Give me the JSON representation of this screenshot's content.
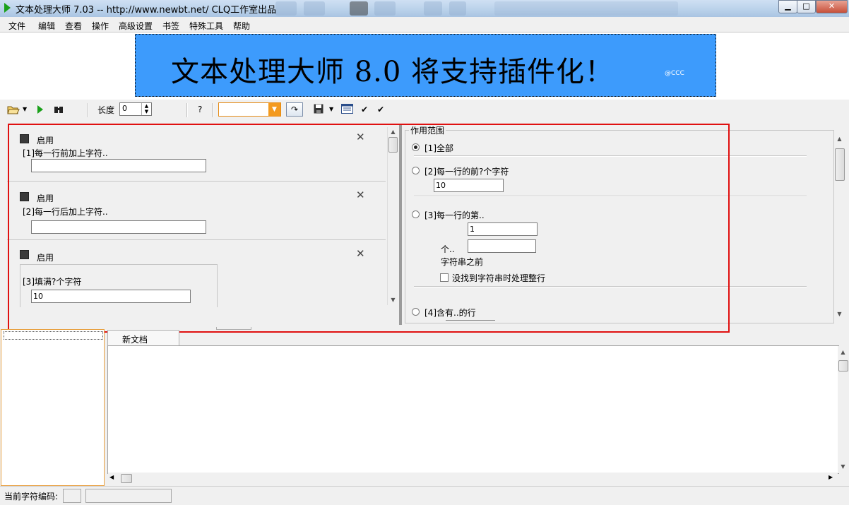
{
  "window": {
    "title": "文本处理大师 7.03 -- http://www.newbt.net/  CLQ工作室出品",
    "minimize_label": "▁",
    "maximize_label": "□",
    "close_label": "✕"
  },
  "menu": [
    "文件",
    "编辑",
    "查看",
    "操作",
    "高级设置",
    "书签",
    "特殊工具",
    "帮助"
  ],
  "banner": {
    "text": "文本处理大师 8.0 将支持插件化！",
    "small": "@CCC",
    "color": "#3d9bfc"
  },
  "toolbar": {
    "length_label": "长度",
    "length_value": "0",
    "help_label": "?",
    "combo_value": ""
  },
  "plugins": [
    {
      "enable_label": "启用",
      "description": "[1]每一行前加上字符..",
      "input_value": ""
    },
    {
      "enable_label": "启用",
      "description": "[2]每一行后加上字符..",
      "input_value": ""
    },
    {
      "enable_label": "启用",
      "description": "[3]填满?个字符",
      "input_value": "10"
    }
  ],
  "scope": {
    "title": "作用范围",
    "options": [
      {
        "label": "[1]全部",
        "selected": true
      },
      {
        "label": "[2]每一行的前?个字符",
        "selected": false,
        "input_value": "10"
      },
      {
        "label": "[3]每一行的第..",
        "selected": false,
        "input_value": "1",
        "count_label": "个..",
        "count_value": "",
        "suffix_label": "字符串之前",
        "checkbox_label": "没找到字符串时处理整行",
        "checked": false
      },
      {
        "label": "[4]含有..的行",
        "selected": false
      }
    ]
  },
  "document": {
    "tab_label": "新文档",
    "content": ""
  },
  "status": {
    "encoding_label": "当前字符编码:",
    "encoding_value": "",
    "extra_value": ""
  },
  "colors": {
    "highlight": "#e01010",
    "combo_accent": "#f39a1f",
    "run_icon": "#1aa01a"
  }
}
